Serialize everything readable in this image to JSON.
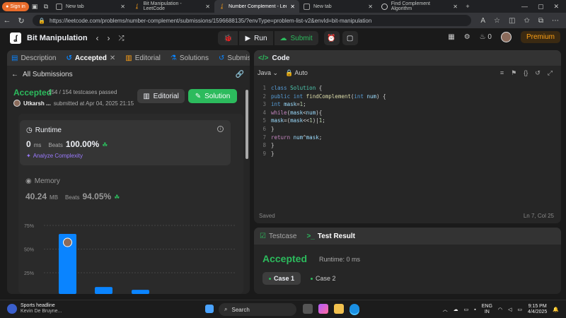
{
  "browser": {
    "signin_label": "Sign in",
    "tabs": [
      {
        "title": "New tab"
      },
      {
        "title": "Bit Manipulation - LeetCode"
      },
      {
        "title": "Number Complement - LeetCode"
      },
      {
        "title": "New tab"
      },
      {
        "title": "Find Complement Algorithm"
      }
    ],
    "url": "https://leetcode.com/problems/number-complement/submissions/1596688135/?envType=problem-list-v2&envId=bit-manipulation"
  },
  "header": {
    "problem_list": "Bit Manipulation",
    "run_label": "Run",
    "submit_label": "Submit",
    "streak_count": "0",
    "premium_label": "Premium"
  },
  "left": {
    "tabs": [
      "Description",
      "Accepted",
      "Editorial",
      "Solutions",
      "Submissions"
    ],
    "all_submissions": "All Submissions",
    "status": "Accepted",
    "testcases": "154 / 154 testcases passed",
    "author": "Utkarsh ...",
    "submitted": "submitted at Apr 04, 2025 21:15",
    "editorial_btn": "Editorial",
    "solution_btn": "Solution",
    "runtime": {
      "label": "Runtime",
      "value": "0",
      "unit": "ms",
      "beats_label": "Beats",
      "beats": "100.00%",
      "analyze": "Analyze Complexity"
    },
    "memory": {
      "label": "Memory",
      "value": "40.24",
      "unit": "MB",
      "beats_label": "Beats",
      "beats": "94.05%"
    }
  },
  "chart_data": {
    "type": "bar",
    "yticks": [
      "75%",
      "50%",
      "25%"
    ],
    "ylim": [
      0,
      100
    ],
    "values": [
      66,
      10,
      7
    ],
    "color": "#0a84ff"
  },
  "code": {
    "title": "Code",
    "language": "Java",
    "mode": "Auto",
    "lines": [
      "class Solution {",
      "    public int findComplement(int num) {",
      "        int mask=1;",
      "        while(mask<num){",
      "            mask=(mask<<1)|1;",
      "        }",
      "        return num^mask;",
      "    }",
      "}"
    ],
    "status": "Saved",
    "position": "Ln 7, Col 25"
  },
  "console": {
    "tab_testcase": "Testcase",
    "tab_result": "Test Result",
    "status": "Accepted",
    "runtime": "Runtime: 0 ms",
    "case1": "Case 1",
    "case2": "Case 2"
  },
  "taskbar": {
    "news_title": "Sports headline",
    "news_sub": "Kevin De Bruyne...",
    "search_placeholder": "Search",
    "lang": "ENG",
    "region": "IN",
    "time": "9:15 PM",
    "date": "4/4/2025"
  }
}
